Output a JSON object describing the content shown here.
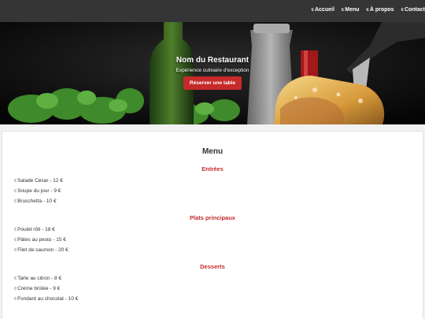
{
  "nav": {
    "items": [
      {
        "icon": "€",
        "label": "Accueil"
      },
      {
        "icon": "€",
        "label": "Menu"
      },
      {
        "icon": "€",
        "label": "À propos"
      },
      {
        "icon": "€",
        "label": "Contact"
      }
    ]
  },
  "hero": {
    "title": "Nom du Restaurant",
    "subtitle": "Expérience culinaire d'exception",
    "button_label": "Réserver une table"
  },
  "menu": {
    "title": "Menu",
    "item_icon": "€",
    "sections": [
      {
        "title": "Entrées",
        "items": [
          "Salade César - 12 €",
          "Soupe du jour - 9 €",
          "Bruschetta - 10 €"
        ]
      },
      {
        "title": "Plats principaux",
        "items": [
          "Poulet rôti - 18 €",
          "Pâtes au pesto - 15 €",
          "Filet de saumon - 20 €"
        ]
      },
      {
        "title": "Desserts",
        "items": [
          "Tarte au citron - 8 €",
          "Crème brûlée - 9 €",
          "Fondant au chocolat - 10 €"
        ]
      }
    ]
  },
  "colors": {
    "topbar": "#353535",
    "accent": "#c62a2a",
    "page_bg": "#f2f2f2"
  }
}
